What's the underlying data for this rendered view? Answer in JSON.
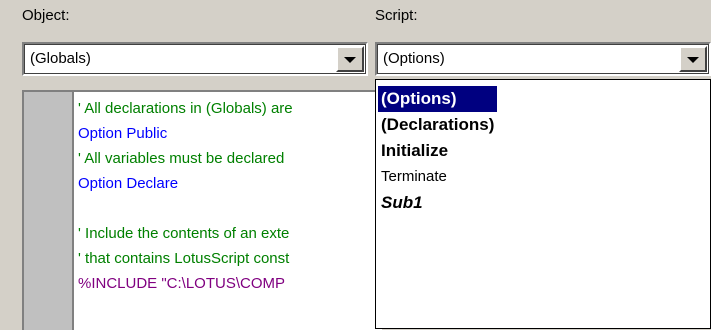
{
  "object": {
    "label": "Object:",
    "value": "(Globals)"
  },
  "script": {
    "label": "Script:",
    "value": "(Options)",
    "options": [
      "(Options)",
      "(Declarations)",
      "Initialize",
      "Terminate",
      "Sub1"
    ]
  },
  "code": {
    "lines": [
      "' All declarations in (Globals) are",
      "Option Public",
      "' All variables must be declared",
      "Option Declare",
      "",
      "' Include the contents of an exte",
      "' that contains LotusScript const",
      "%INCLUDE \"C:\\LOTUS\\COMP"
    ]
  },
  "colors": {
    "comment": "#008000",
    "keyword": "#0000ff",
    "directive": "#800080",
    "selection": "#000080"
  }
}
